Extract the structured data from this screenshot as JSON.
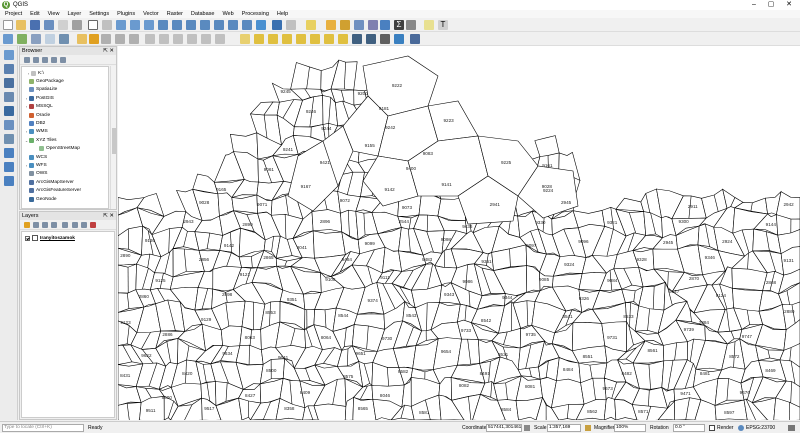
{
  "window": {
    "title": "QGIS",
    "min": "–",
    "max": "▢",
    "close": "✕"
  },
  "menu": [
    "Project",
    "Edit",
    "View",
    "Layer",
    "Settings",
    "Plugins",
    "Vector",
    "Raster",
    "Database",
    "Web",
    "Processing",
    "Help"
  ],
  "browser": {
    "title": "Browser",
    "items": [
      {
        "label": "K:\\",
        "indent": 2,
        "arrow": "›",
        "icon": "drive-icon",
        "color": "#c0c0c0"
      },
      {
        "label": "GeoPackage",
        "indent": 0,
        "arrow": "",
        "icon": "geopackage-icon",
        "color": "#8fb36a"
      },
      {
        "label": "SpatiaLite",
        "indent": 0,
        "arrow": "",
        "icon": "spatialite-icon",
        "color": "#6a8fbf"
      },
      {
        "label": "PostGIS",
        "indent": 0,
        "arrow": "›",
        "icon": "postgis-icon",
        "color": "#3b6aa0"
      },
      {
        "label": "MSSQL",
        "indent": 0,
        "arrow": "›",
        "icon": "mssql-icon",
        "color": "#b04040"
      },
      {
        "label": "Oracle",
        "indent": 0,
        "arrow": "",
        "icon": "oracle-icon",
        "color": "#d06030"
      },
      {
        "label": "DB2",
        "indent": 0,
        "arrow": "",
        "icon": "db2-icon",
        "color": "#5080c0"
      },
      {
        "label": "WMS",
        "indent": 0,
        "arrow": "›",
        "icon": "wms-icon",
        "color": "#4a8fc0"
      },
      {
        "label": "XYZ Tiles",
        "indent": 0,
        "arrow": "⌄",
        "icon": "xyz-tiles-icon",
        "color": "#6ab06a"
      },
      {
        "label": "OpenStreetMap",
        "indent": 10,
        "arrow": "",
        "icon": "openstreetmap-icon",
        "color": "#90c090"
      },
      {
        "label": "WCS",
        "indent": 0,
        "arrow": "",
        "icon": "wcs-icon",
        "color": "#4a8fc0"
      },
      {
        "label": "WFS",
        "indent": 0,
        "arrow": "›",
        "icon": "wfs-icon",
        "color": "#4a8fc0"
      },
      {
        "label": "OWS",
        "indent": 0,
        "arrow": "",
        "icon": "ows-icon",
        "color": "#8090a0"
      },
      {
        "label": "ArcGisMapServer",
        "indent": 0,
        "arrow": "",
        "icon": "arcgis-mapserver-icon",
        "color": "#5070a0"
      },
      {
        "label": "ArcGisFeatureServer",
        "indent": 0,
        "arrow": "",
        "icon": "arcgis-featureserver-icon",
        "color": "#5070a0"
      },
      {
        "label": "GeoNode",
        "indent": 0,
        "arrow": "",
        "icon": "geonode-icon",
        "color": "#3a6a9a"
      }
    ]
  },
  "layers": {
    "title": "Layers",
    "layer_name": "Iranyitoszamok"
  },
  "panel_buttons": "⇱ ✕",
  "status": {
    "locator_placeholder": "Type to locate (Ctrl+K)",
    "ready": "Ready",
    "coordinate_label": "Coordinate",
    "coordinate": "517441,301461",
    "scale_label": "Scale",
    "scale": "1:357,169",
    "magnifier_label": "Magnifier",
    "magnifier": "100%",
    "rotation_label": "Rotation",
    "rotation": "0.0 °",
    "render_label": "Render",
    "crs": "EPSG:23700"
  },
  "map": {
    "labels": [
      "9224",
      "9225",
      "9223",
      "9222",
      "9245",
      "9200",
      "9246",
      "9181",
      "9244",
      "9242",
      "9241",
      "9155",
      "9083",
      "9061",
      "9421",
      "9400",
      "9161",
      "9165",
      "9167",
      "9142",
      "9141",
      "9028",
      "9028",
      "9071",
      "9072",
      "9073",
      "2941",
      "2945",
      "2911",
      "2942",
      "2943",
      "2890",
      "2896",
      "2544",
      "9436",
      "9330",
      "9321",
      "9300",
      "9144",
      "9136",
      "9142",
      "9041",
      "9099",
      "9098",
      "9097",
      "9096",
      "2945",
      "2924",
      "2890",
      "2856",
      "2865",
      "9484",
      "9483",
      "9351",
      "9324",
      "9328",
      "9346",
      "9131",
      "9125",
      "9121",
      "9108",
      "9111",
      "9086",
      "9085",
      "9084",
      "2870",
      "2868",
      "2860",
      "2898",
      "9351",
      "9374",
      "9343",
      "9344",
      "9326",
      "9127",
      "9124",
      "9123",
      "9129",
      "8553",
      "8544",
      "8543",
      "8542",
      "8541",
      "8533",
      "2884",
      "2880",
      "2886",
      "8063",
      "8064",
      "9730",
      "9733",
      "9735",
      "9731",
      "9739",
      "9747",
      "9622",
      "9634",
      "9641",
      "9651",
      "9654",
      "8531",
      "8551",
      "8561",
      "8572",
      "8431",
      "8420",
      "8500",
      "8575",
      "8582",
      "8491",
      "8484",
      "8482",
      "8481",
      "8469",
      "8400",
      "8427",
      "8409",
      "8046",
      "8082",
      "8081",
      "9673",
      "9471",
      "9476",
      "9511",
      "9517",
      "8358",
      "8565",
      "8581",
      "8584",
      "8562",
      "8571",
      "8597"
    ]
  }
}
